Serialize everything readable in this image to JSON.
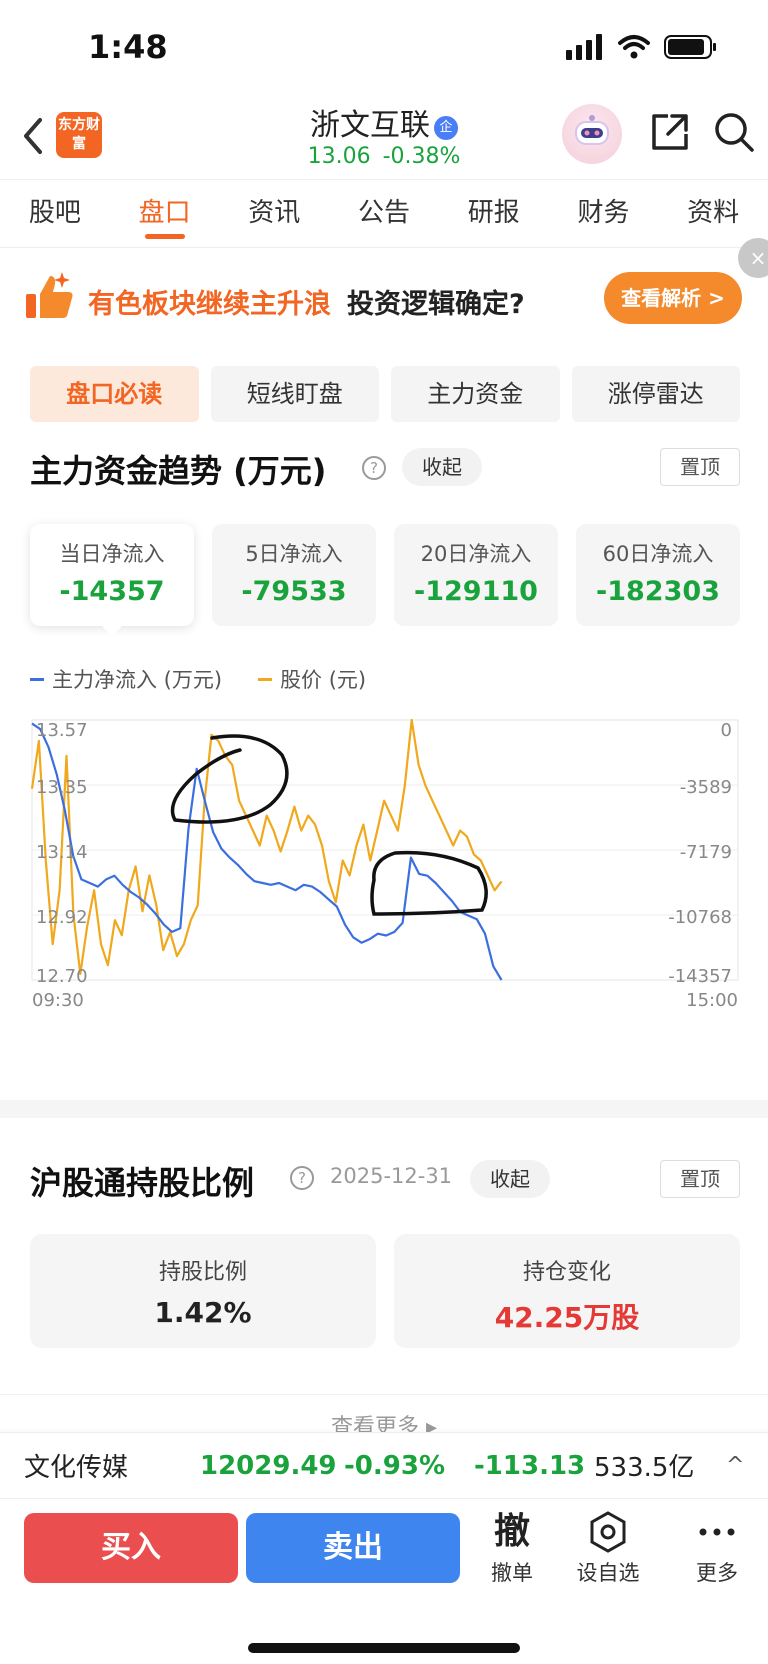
{
  "status_bar": {
    "time": "1:48"
  },
  "header": {
    "app_logo": "东方财富",
    "stock_name": "浙文互联",
    "stock_badge": "企",
    "price": "13.06",
    "change_pct": "-0.38%"
  },
  "tabs": [
    "股吧",
    "盘口",
    "资讯",
    "公告",
    "研报",
    "财务",
    "资料"
  ],
  "banner": {
    "highlight": "有色板块继续主升浪",
    "text": "投资逻辑确定?",
    "button": "查看解析 >"
  },
  "subtabs": [
    "盘口必读",
    "短线盯盘",
    "主力资金",
    "涨停雷达"
  ],
  "capital_flow": {
    "title": "主力资金趋势 (万元)",
    "collapse": "收起",
    "pin": "置顶",
    "cards": [
      {
        "label": "当日净流入",
        "value": "-14357"
      },
      {
        "label": "5日净流入",
        "value": "-79533"
      },
      {
        "label": "20日净流入",
        "value": "-129110"
      },
      {
        "label": "60日净流入",
        "value": "-182303"
      }
    ],
    "legend": [
      {
        "label": "主力净流入 (万元)",
        "color": "#3b6fe0"
      },
      {
        "label": "股价 (元)",
        "color": "#f0a81c"
      }
    ]
  },
  "chart_data": {
    "type": "line",
    "x_start": "09:30",
    "x_end": "15:00",
    "left_axis_ticks": [
      "13.57",
      "13.35",
      "13.14",
      "12.92",
      "12.70"
    ],
    "right_axis_ticks": [
      "0",
      "-3589",
      "-7179",
      "-10768",
      "-14357"
    ],
    "price_range": [
      12.7,
      13.57
    ],
    "flow_range": [
      -14357,
      0
    ],
    "series": [
      {
        "name": "股价 (元)",
        "color": "#f0a81c",
        "axis": "left",
        "values": [
          13.34,
          13.5,
          13.1,
          12.82,
          13.0,
          13.45,
          12.92,
          12.72,
          12.88,
          13.0,
          12.82,
          12.75,
          12.9,
          12.85,
          13.0,
          13.08,
          12.93,
          13.05,
          12.95,
          12.8,
          12.86,
          12.78,
          12.82,
          12.9,
          12.95,
          13.3,
          13.52,
          13.5,
          13.45,
          13.42,
          13.3,
          13.25,
          13.2,
          13.15,
          13.25,
          13.2,
          13.13,
          13.2,
          13.28,
          13.2,
          13.25,
          13.22,
          13.15,
          13.03,
          12.96,
          13.1,
          13.05,
          13.15,
          13.22,
          13.1,
          13.2,
          13.3,
          13.25,
          13.2,
          13.35,
          13.58,
          13.42,
          13.35,
          13.3,
          13.25,
          13.2,
          13.15,
          13.2,
          13.18,
          13.12,
          13.1,
          13.05,
          13.0,
          13.03
        ]
      },
      {
        "name": "主力净流入 (万元)",
        "color": "#3b6fe0",
        "axis": "right",
        "values": [
          -200,
          -500,
          -1500,
          -3000,
          -5000,
          -7500,
          -8800,
          -9000,
          -9200,
          -8800,
          -8600,
          -9100,
          -9500,
          -9800,
          -10200,
          -10700,
          -11300,
          -11700,
          -11500,
          -6000,
          -2700,
          -4500,
          -6200,
          -7100,
          -7600,
          -8000,
          -8500,
          -8900,
          -9000,
          -9100,
          -9000,
          -9200,
          -9400,
          -9100,
          -9200,
          -9500,
          -9900,
          -10300,
          -11300,
          -12000,
          -12300,
          -12100,
          -11800,
          -11900,
          -11700,
          -11200,
          -7600,
          -8500,
          -8600,
          -9000,
          -9500,
          -10000,
          -10600,
          -10800,
          -11000,
          -11800,
          -13600,
          -14357
        ]
      }
    ]
  },
  "hk_holding": {
    "title": "沪股通持股比例",
    "date": "2025-12-31",
    "collapse": "收起",
    "pin": "置顶",
    "ratio_label": "持股比例",
    "ratio_value": "1.42%",
    "change_label": "持仓变化",
    "change_value": "42.25万股",
    "more": "查看更多 ▸"
  },
  "sector": {
    "name": "文化传媒",
    "index": "12029.49",
    "pct": "-0.93%",
    "change": "-113.13",
    "amount": "533.5亿",
    "caret": "^"
  },
  "bottom_bar": {
    "buy": "买入",
    "sell": "卖出",
    "cancel_icon": "撤",
    "cancel_label": "撤单",
    "watchlist_label": "设自选",
    "more_label": "更多"
  }
}
